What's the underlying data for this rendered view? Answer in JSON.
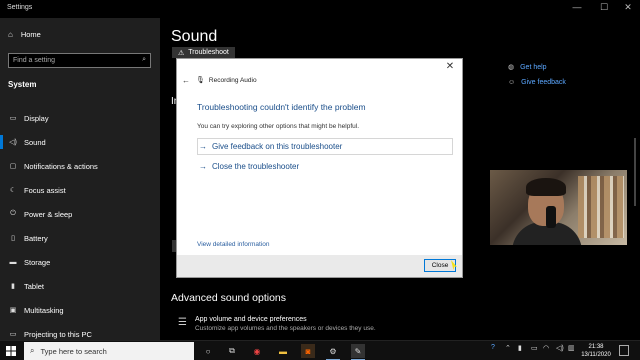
{
  "window": {
    "title": "Settings",
    "minimize_icon": "—",
    "maximize_icon": "☐",
    "close_icon": "✕"
  },
  "sidebar": {
    "home_label": "Home",
    "search_placeholder": "Find a setting",
    "section_label": "System",
    "items": [
      {
        "label": "Display",
        "icon": "display-icon"
      },
      {
        "label": "Sound",
        "icon": "speaker-icon",
        "active": true
      },
      {
        "label": "Notifications & actions",
        "icon": "notifications-icon"
      },
      {
        "label": "Focus assist",
        "icon": "moon-icon"
      },
      {
        "label": "Power & sleep",
        "icon": "power-icon"
      },
      {
        "label": "Battery",
        "icon": "battery-icon"
      },
      {
        "label": "Storage",
        "icon": "storage-icon"
      },
      {
        "label": "Tablet",
        "icon": "tablet-icon"
      },
      {
        "label": "Multitasking",
        "icon": "multitasking-icon"
      },
      {
        "label": "Projecting to this PC",
        "icon": "projecting-icon"
      }
    ]
  },
  "main": {
    "title": "Sound",
    "troubleshoot_label": "Troubleshoot",
    "partial_heading": "In",
    "related": {
      "get_help": "Get help",
      "give_feedback": "Give feedback"
    },
    "advanced_title": "Advanced sound options",
    "app_volume_title": "App volume and device preferences",
    "app_volume_desc": "Customize app volumes and the speakers or devices they use."
  },
  "dialog": {
    "header": "Recording Audio",
    "heading": "Troubleshooting couldn't identify the problem",
    "subtext": "You can try exploring other options that might be helpful.",
    "link_feedback": "Give feedback on this troubleshooter",
    "link_close": "Close the troubleshooter",
    "view_details": "View detailed information",
    "close_button": "Close"
  },
  "taskbar": {
    "search_placeholder": "Type here to search",
    "time": "21:38",
    "date": "13/11/2020"
  },
  "colors": {
    "accent": "#0078d7",
    "link": "#5ba7ff",
    "dialog_heading": "#1a4e8a"
  }
}
